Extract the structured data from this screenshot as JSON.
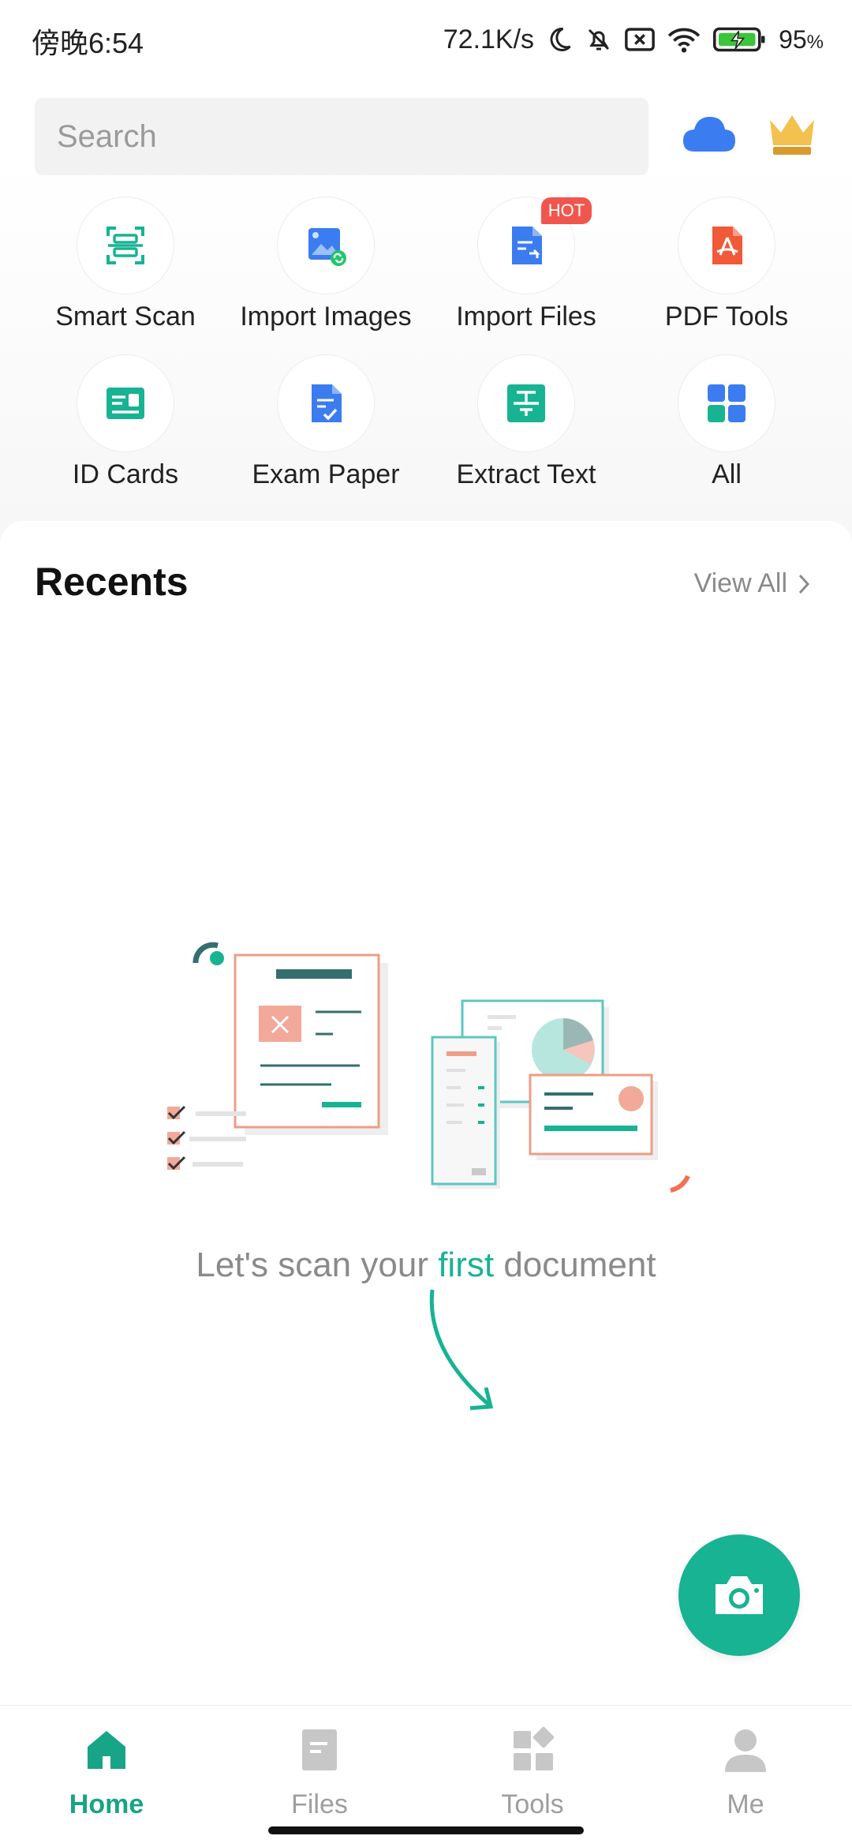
{
  "status_bar": {
    "time": "傍晚6:54",
    "net_speed": "72.1K/s",
    "battery_pct": "95",
    "battery_unit": "%",
    "icons": [
      "moon-icon",
      "mute-icon",
      "sim-off-icon",
      "wifi-icon",
      "battery-icon"
    ]
  },
  "header": {
    "search_placeholder": "Search",
    "cloud_icon": "cloud-icon",
    "crown_icon": "crown-icon"
  },
  "quick_actions": [
    {
      "label": "Smart Scan",
      "icon": "smart-scan-icon"
    },
    {
      "label": "Import Images",
      "icon": "import-images-icon"
    },
    {
      "label": "Import Files",
      "icon": "import-files-icon",
      "badge": "HOT"
    },
    {
      "label": "PDF Tools",
      "icon": "pdf-tools-icon"
    },
    {
      "label": "ID Cards",
      "icon": "id-cards-icon"
    },
    {
      "label": "Exam Paper",
      "icon": "exam-paper-icon"
    },
    {
      "label": "Extract Text",
      "icon": "extract-text-icon"
    },
    {
      "label": "All",
      "icon": "all-apps-icon"
    }
  ],
  "recents": {
    "title": "Recents",
    "view_all": "View All",
    "empty_text_before": "Let's scan your ",
    "empty_text_accent": "first",
    "empty_text_after": " document"
  },
  "fab": {
    "icon": "camera-icon"
  },
  "bottom_nav": [
    {
      "label": "Home",
      "icon": "home-icon",
      "active": true
    },
    {
      "label": "Files",
      "icon": "files-icon",
      "active": false
    },
    {
      "label": "Tools",
      "icon": "tools-icon",
      "active": false
    },
    {
      "label": "Me",
      "icon": "me-icon",
      "active": false
    }
  ],
  "colors": {
    "accent": "#17b393",
    "hot_badge": "#f0564d",
    "cloud": "#3b7cf0",
    "crown": "#e8b34a",
    "inactive_nav": "#9e9e9e"
  }
}
